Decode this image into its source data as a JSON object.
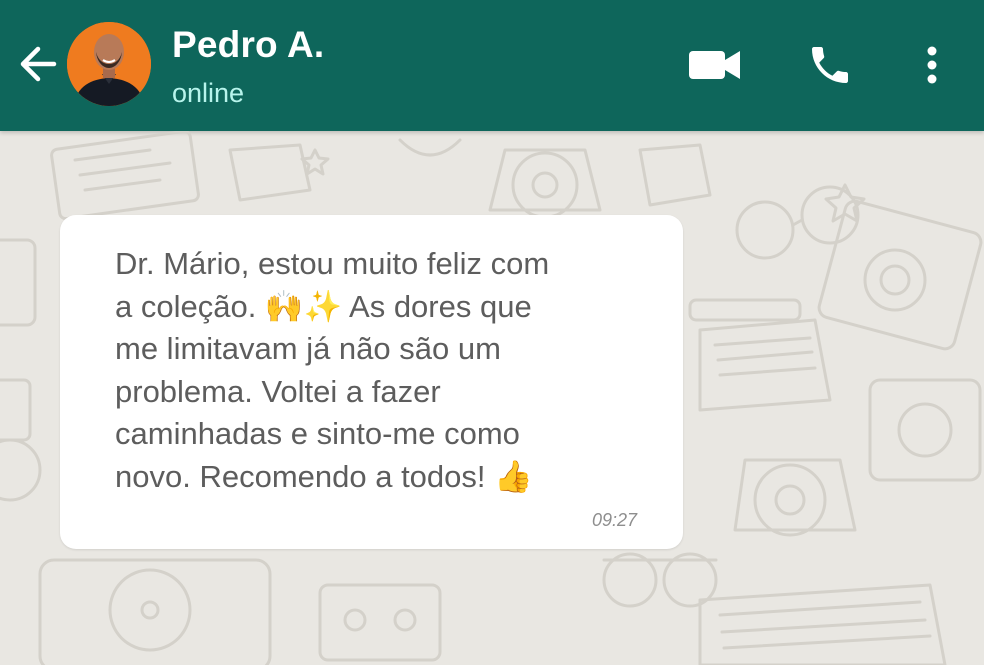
{
  "header": {
    "contact_name": "Pedro A.",
    "status": "online",
    "background_color": "#0e665b",
    "status_color": "#b7f4ec",
    "icons": {
      "back": "arrow-left-icon",
      "video": "video-camera-icon",
      "call": "phone-icon",
      "menu": "more-vertical-icon"
    }
  },
  "message": {
    "text": "Dr. Mário, estou muito feliz com\na coleção. 🙌✨ As dores que\nme limitavam já não são um\nproblema. Voltei a fazer\ncaminhadas e sinto-me como\nnovo. Recomendo a todos! 👍",
    "time": "09:27",
    "bubble_color": "#ffffff"
  },
  "chat": {
    "wallpaper_color": "#e9e7e2"
  }
}
